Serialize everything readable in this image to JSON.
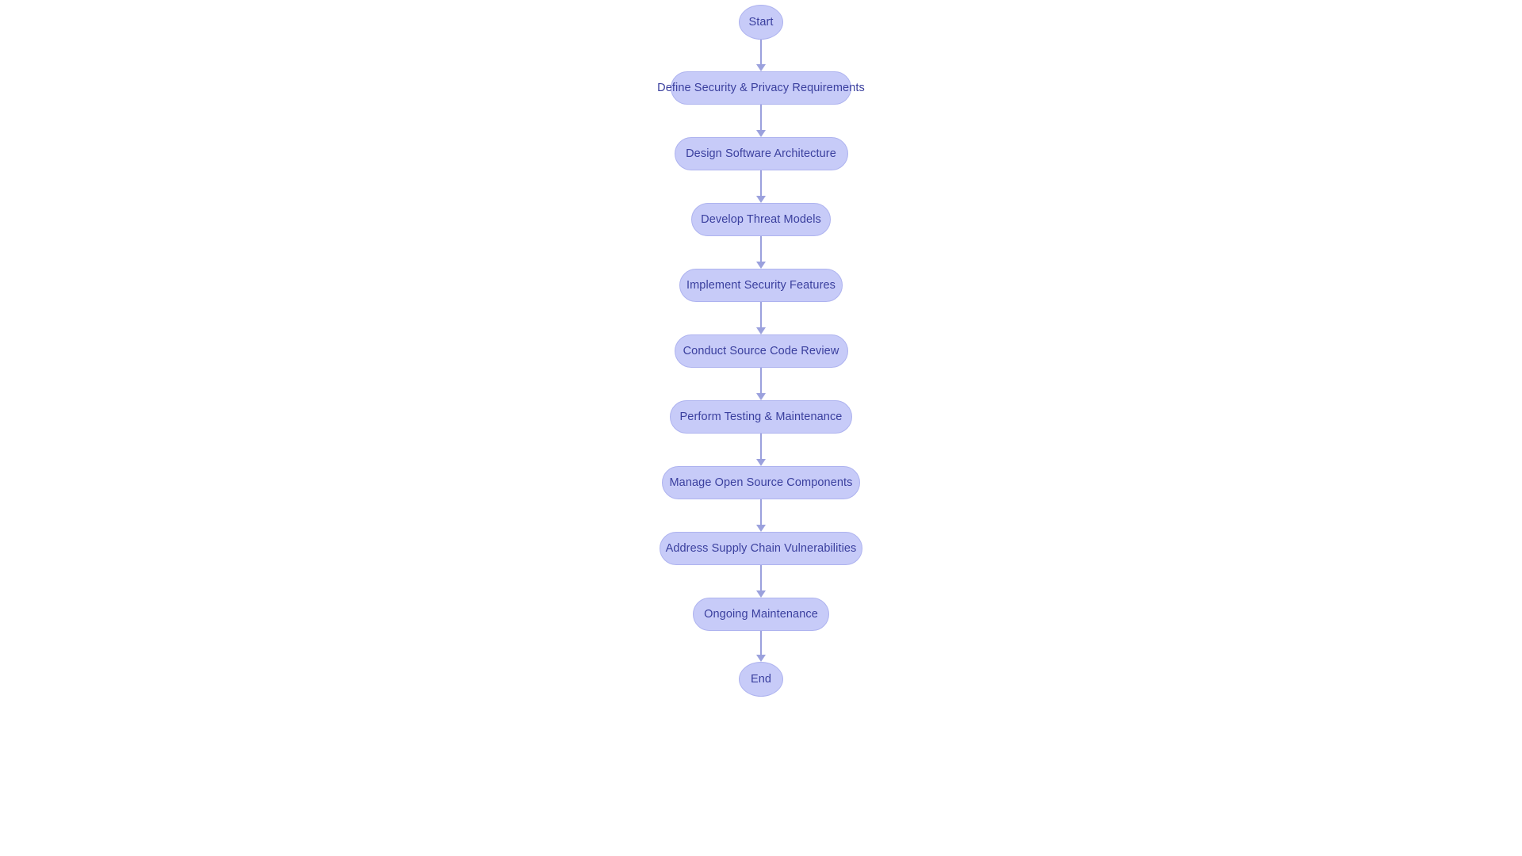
{
  "diagram": {
    "type": "flowchart",
    "orientation": "vertical",
    "background_color": "#ffffff",
    "node_fill_color": "#c7cbf8",
    "node_border_color": "#aeb3ef",
    "node_text_color": "#3a3f9e",
    "connector_color": "#9ba1dd",
    "nodes": [
      {
        "id": "start",
        "label": "Start",
        "shape": "ellipse"
      },
      {
        "id": "n1",
        "label": "Define Security & Privacy Requirements",
        "shape": "rounded-rect"
      },
      {
        "id": "n2",
        "label": "Design Software Architecture",
        "shape": "rounded-rect"
      },
      {
        "id": "n3",
        "label": "Develop Threat Models",
        "shape": "rounded-rect"
      },
      {
        "id": "n4",
        "label": "Implement Security Features",
        "shape": "rounded-rect"
      },
      {
        "id": "n5",
        "label": "Conduct Source Code Review",
        "shape": "rounded-rect"
      },
      {
        "id": "n6",
        "label": "Perform Testing & Maintenance",
        "shape": "rounded-rect"
      },
      {
        "id": "n7",
        "label": "Manage Open Source Components",
        "shape": "rounded-rect"
      },
      {
        "id": "n8",
        "label": "Address Supply Chain Vulnerabilities",
        "shape": "rounded-rect"
      },
      {
        "id": "n9",
        "label": "Ongoing Maintenance",
        "shape": "rounded-rect"
      },
      {
        "id": "end",
        "label": "End",
        "shape": "ellipse"
      }
    ],
    "edges": [
      {
        "from": "start",
        "to": "n1"
      },
      {
        "from": "n1",
        "to": "n2"
      },
      {
        "from": "n2",
        "to": "n3"
      },
      {
        "from": "n3",
        "to": "n4"
      },
      {
        "from": "n4",
        "to": "n5"
      },
      {
        "from": "n5",
        "to": "n6"
      },
      {
        "from": "n6",
        "to": "n7"
      },
      {
        "from": "n7",
        "to": "n8"
      },
      {
        "from": "n8",
        "to": "n9"
      },
      {
        "from": "n9",
        "to": "end"
      }
    ]
  }
}
